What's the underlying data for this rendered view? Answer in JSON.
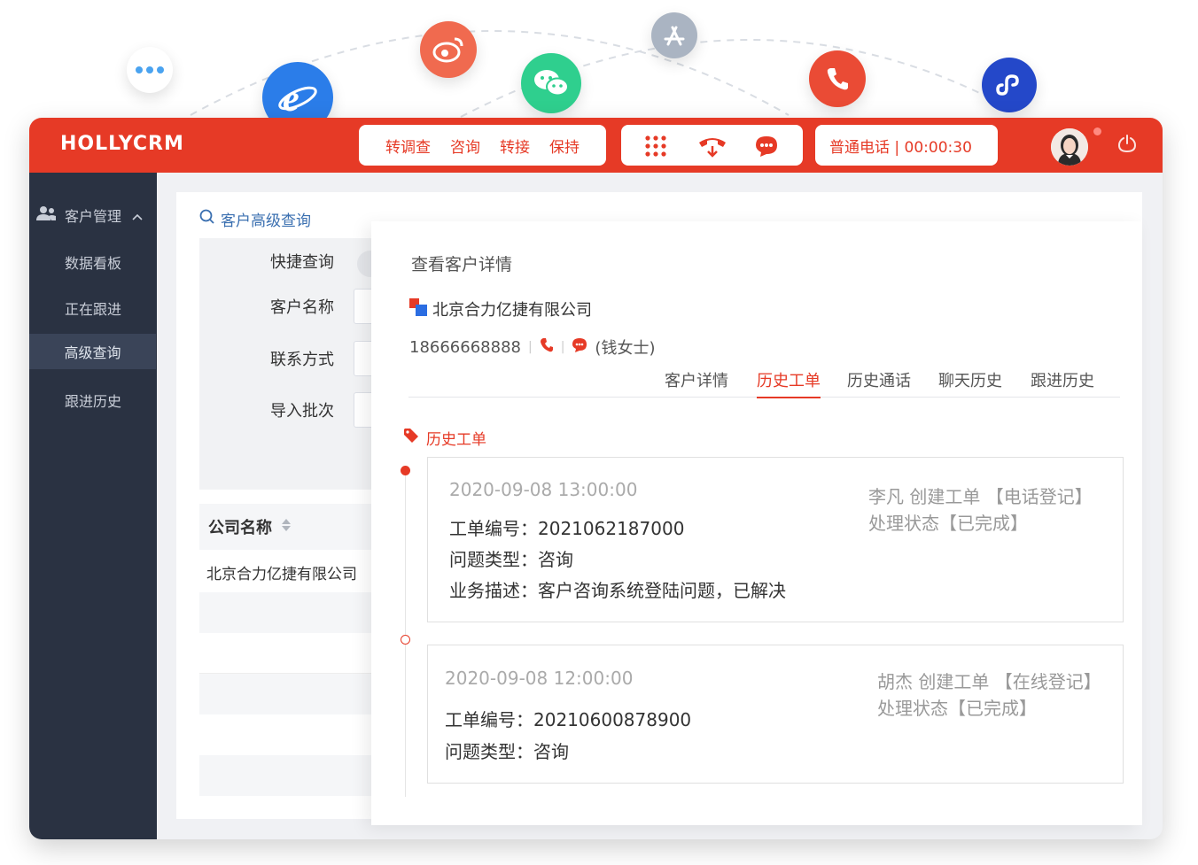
{
  "floating_icons": [
    {
      "name": "more-icon",
      "color": "#ffffff"
    },
    {
      "name": "ie-browser-icon",
      "color": "#2b7de9"
    },
    {
      "name": "weibo-icon",
      "color": "#f06a4f"
    },
    {
      "name": "wechat-icon",
      "color": "#2fcf8e"
    },
    {
      "name": "app-store-icon",
      "color": "#aab4c2"
    },
    {
      "name": "phone-icon",
      "color": "#ea4b35"
    },
    {
      "name": "mini-program-link-icon",
      "color": "#2448c9"
    }
  ],
  "header": {
    "brand": "HOLLYCRM",
    "actions": [
      "转调查",
      "咨询",
      "转接",
      "保持"
    ],
    "call_type": "普通电话",
    "call_timer": "00:00:30",
    "accent": "#e63a26"
  },
  "sidebar": {
    "group_label": "客户管理",
    "items": [
      {
        "label": "数据看板",
        "active": false
      },
      {
        "label": "正在跟进",
        "active": false
      },
      {
        "label": "高级查询",
        "active": true
      },
      {
        "label": "跟进历史",
        "active": false
      }
    ]
  },
  "search": {
    "title": "客户高级查询",
    "fields": [
      {
        "label": "快捷查询"
      },
      {
        "label": "客户名称"
      },
      {
        "label": "联系方式"
      },
      {
        "label": "导入批次"
      }
    ],
    "table": {
      "header": "公司名称",
      "rows": [
        "北京合力亿捷有限公司"
      ]
    }
  },
  "detail": {
    "title": "查看客户详情",
    "company": "北京合力亿捷有限公司",
    "phone": "18666668888",
    "contact_name": "(钱女士)",
    "tabs": [
      {
        "label": "客户详情",
        "active": false
      },
      {
        "label": "历史工单",
        "active": true
      },
      {
        "label": "历史通话",
        "active": false
      },
      {
        "label": "聊天历史",
        "active": false
      },
      {
        "label": "跟进历史",
        "active": false
      }
    ],
    "section_title": "历史工单",
    "tickets": [
      {
        "time": "2020-09-08 13:00:00",
        "lines": [
          "工单编号：2021062187000",
          "问题类型：咨询",
          "业务描述：客户咨询系统登陆问题，已解决"
        ],
        "creator": "李凡  创建工单  【电话登记】",
        "status": "处理状态【已完成】"
      },
      {
        "time": "2020-09-08 12:00:00",
        "lines": [
          "工单编号：20210600878900",
          "问题类型：咨询"
        ],
        "creator": "胡杰 创建工单  【在线登记】",
        "status": "处理状态【已完成】"
      }
    ]
  }
}
